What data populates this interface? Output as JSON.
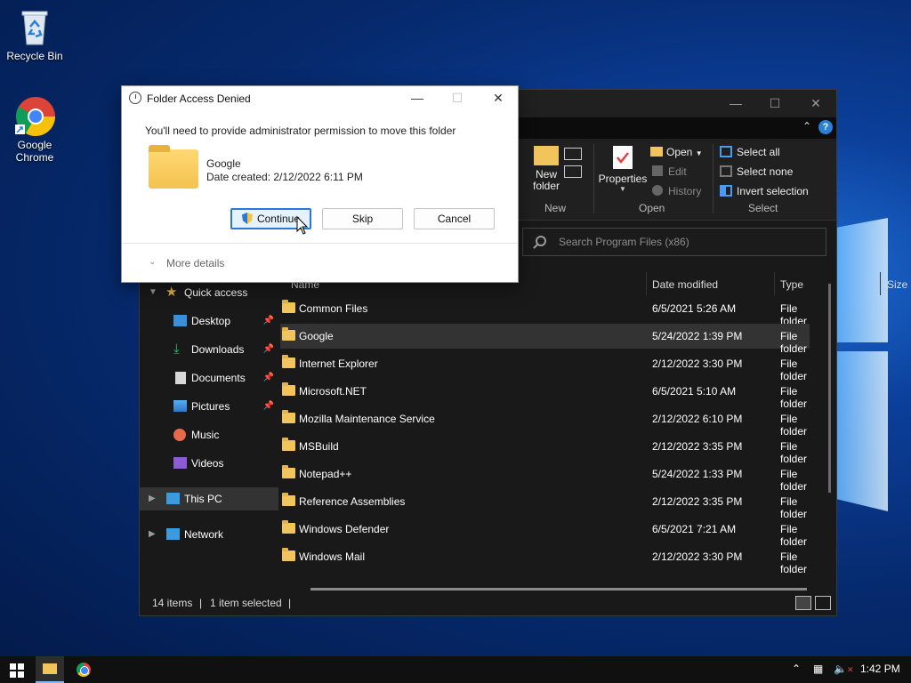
{
  "desktop": {
    "icons": [
      {
        "label": "Recycle Bin"
      },
      {
        "label": "Google Chrome"
      }
    ]
  },
  "explorer": {
    "ribbon": {
      "new": {
        "new_folder": "New folder",
        "group": "New"
      },
      "open": {
        "properties": "Properties",
        "open": "Open",
        "edit": "Edit",
        "history": "History",
        "group": "Open"
      },
      "select": {
        "select_all": "Select all",
        "select_none": "Select none",
        "invert": "Invert selection",
        "group": "Select"
      }
    },
    "search_placeholder": "Search Program Files (x86)",
    "columns": {
      "name": "Name",
      "date": "Date modified",
      "type": "Type",
      "size": "Size"
    },
    "nav": {
      "quick_access": "Quick access",
      "items": [
        {
          "label": "Desktop",
          "pinned": true
        },
        {
          "label": "Downloads",
          "pinned": true
        },
        {
          "label": "Documents",
          "pinned": true
        },
        {
          "label": "Pictures",
          "pinned": true
        },
        {
          "label": "Music",
          "pinned": false
        },
        {
          "label": "Videos",
          "pinned": false
        }
      ],
      "this_pc": "This PC",
      "network": "Network"
    },
    "rows": [
      {
        "name": "Common Files",
        "date": "6/5/2021 5:26 AM",
        "type": "File folder"
      },
      {
        "name": "Google",
        "date": "5/24/2022 1:39 PM",
        "type": "File folder"
      },
      {
        "name": "Internet Explorer",
        "date": "2/12/2022 3:30 PM",
        "type": "File folder"
      },
      {
        "name": "Microsoft.NET",
        "date": "6/5/2021 5:10 AM",
        "type": "File folder"
      },
      {
        "name": "Mozilla Maintenance Service",
        "date": "2/12/2022 6:10 PM",
        "type": "File folder"
      },
      {
        "name": "MSBuild",
        "date": "2/12/2022 3:35 PM",
        "type": "File folder"
      },
      {
        "name": "Notepad++",
        "date": "5/24/2022 1:33 PM",
        "type": "File folder"
      },
      {
        "name": "Reference Assemblies",
        "date": "2/12/2022 3:35 PM",
        "type": "File folder"
      },
      {
        "name": "Windows Defender",
        "date": "6/5/2021 7:21 AM",
        "type": "File folder"
      },
      {
        "name": "Windows Mail",
        "date": "2/12/2022 3:30 PM",
        "type": "File folder"
      }
    ],
    "status": {
      "items": "14 items",
      "selected": "1 item selected"
    }
  },
  "dialog": {
    "title": "Folder Access Denied",
    "message": "You'll need to provide administrator permission to move this folder",
    "folder_name": "Google",
    "folder_date": "Date created: 2/12/2022 6:11 PM",
    "continue": "Continue",
    "skip": "Skip",
    "cancel": "Cancel",
    "more_details": "More details"
  },
  "taskbar": {
    "time": "1:42 PM"
  },
  "colors": {
    "accent": "#2b79d6",
    "folder": "#f2c55c"
  }
}
